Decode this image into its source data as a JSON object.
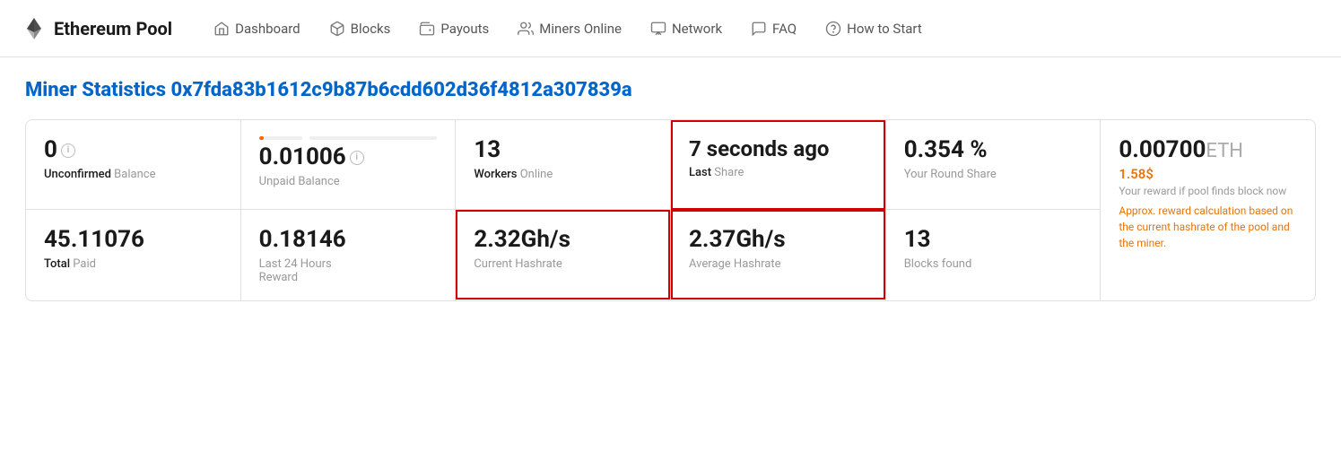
{
  "header": {
    "logo_text": "Ethereum Pool",
    "nav_items": [
      {
        "id": "dashboard",
        "label": "Dashboard",
        "icon": "home"
      },
      {
        "id": "blocks",
        "label": "Blocks",
        "icon": "cube"
      },
      {
        "id": "payouts",
        "label": "Payouts",
        "icon": "wallet"
      },
      {
        "id": "miners-online",
        "label": "Miners Online",
        "icon": "users"
      },
      {
        "id": "network",
        "label": "Network",
        "icon": "monitor"
      },
      {
        "id": "faq",
        "label": "FAQ",
        "icon": "chat"
      },
      {
        "id": "how-to-start",
        "label": "How to Start",
        "icon": "question"
      }
    ]
  },
  "page": {
    "title_prefix": "Miner Statistics ",
    "title_address": "0x7fda83b1612c9b87b6cdd602d36f4812a307839a"
  },
  "stats": {
    "unconfirmed_balance": {
      "value": "0",
      "label_accent": "Unconfirmed",
      "label_rest": " Balance"
    },
    "unpaid_balance": {
      "value": "0.01006",
      "label": "Unpaid Balance",
      "progress": 12
    },
    "workers_online": {
      "value": "13",
      "label_accent": "Workers",
      "label_rest": " Online"
    },
    "last_share": {
      "value": "7 seconds ago",
      "label_accent": "Last",
      "label_rest": " Share"
    },
    "round_share": {
      "value": "0.354 %",
      "label": "Your Round Share"
    },
    "eth_reward": {
      "value": "0.00700",
      "unit": " ETH",
      "sub_value": "1.58$",
      "desc": "Your reward if pool finds block now",
      "approx_text": "Approx. reward calculation based on the current hashrate of the pool and the miner."
    },
    "total_paid": {
      "value": "45.11076",
      "label_accent": "Total",
      "label_rest": " Paid"
    },
    "last_24h": {
      "value": "0.18146",
      "label_line1": "Last 24 Hours",
      "label_line2": "Reward"
    },
    "current_hashrate": {
      "value": "2.32",
      "unit": " Gh/s",
      "label": "Current Hashrate"
    },
    "average_hashrate": {
      "value": "2.37",
      "unit": " Gh/s",
      "label": "Average Hashrate"
    },
    "blocks_found": {
      "value": "13",
      "label": "Blocks found"
    }
  }
}
